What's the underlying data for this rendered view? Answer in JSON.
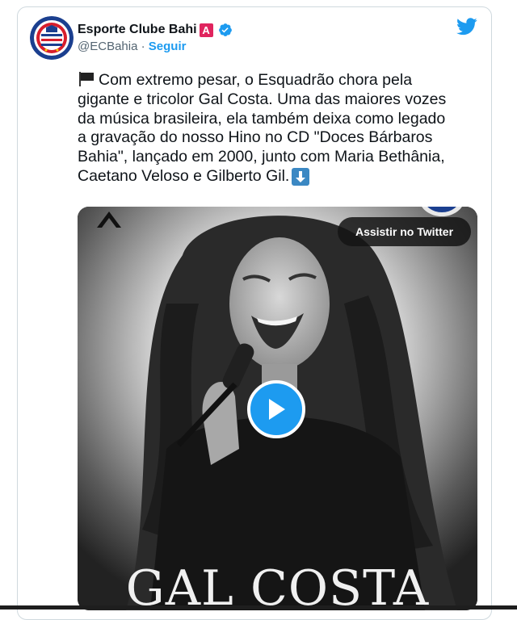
{
  "account": {
    "display_name": "Esporte Clube Bahi",
    "badge_letter": "A",
    "handle": "@ECBahia",
    "separator": " · ",
    "follow_label": "Seguir",
    "verified": true
  },
  "tweet": {
    "text": "Com extremo pesar, o Esquadrão chora pela\ngigante e tricolor Gal Costa. Uma das maiores vozes\nda música brasileira, ela também deixa como legado\na gravação do nosso Hino no CD \"Doces Bárbaros\nBahia\", lançado em 2000, junto com Maria Bethânia,\nCaetano Veloso e Gilberto Gil.",
    "leading_emoji": "black-flag-icon",
    "trailing_emoji": "down-arrow-icon"
  },
  "media": {
    "type": "video",
    "watch_label": "Assistir no Twitter",
    "caption": "GAL COSTA"
  },
  "colors": {
    "twitter_blue": "#1d9bf0",
    "text": "#0f1419",
    "secondary": "#536471",
    "badge_red": "#e0245e"
  },
  "icons": [
    "twitter-logo-icon",
    "verified-icon",
    "play-icon",
    "mourning-ribbon-icon",
    "club-crest-icon"
  ]
}
